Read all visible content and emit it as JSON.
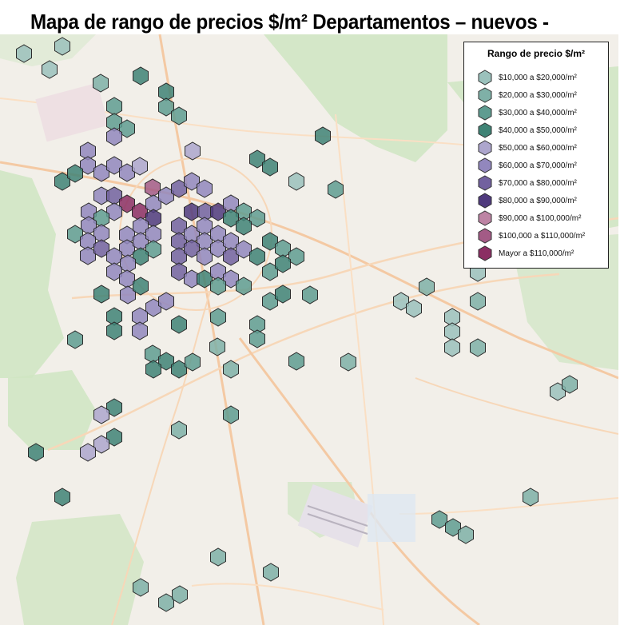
{
  "title": "Mapa de rango de precios $/m² Departamentos – nuevos -",
  "legend": {
    "title": "Rango de precio $/m²",
    "items": [
      {
        "label": "$10,000 a $20,000/m²",
        "color": "#9bc1bc"
      },
      {
        "label": "$20,000 a $30,000/m²",
        "color": "#7fb0a7"
      },
      {
        "label": "$30,000 a $40,000/m²",
        "color": "#5f9c91"
      },
      {
        "label": "$40,000 a $50,000/m²",
        "color": "#3f8375"
      },
      {
        "label": "$50,000 a $60,000/m²",
        "color": "#ada6cd"
      },
      {
        "label": "$60,000 a $70,000/m²",
        "color": "#9287bd"
      },
      {
        "label": "$70,000 a $80,000/m²",
        "color": "#72619f"
      },
      {
        "label": "$80,000 a $90,000/m²",
        "color": "#4f3a7d"
      },
      {
        "label": "$90,000 a $100,000/m²",
        "color": "#bd84a4"
      },
      {
        "label": "$100,000 a $110,000/m²",
        "color": "#a35b86"
      },
      {
        "label": "Mayor a $110,000/m²",
        "color": "#8b2e63"
      }
    ]
  },
  "map": {
    "background_color": "#f2efe9",
    "park_color": "#cfe5c2",
    "road_color": "#f4c9a3"
  }
}
